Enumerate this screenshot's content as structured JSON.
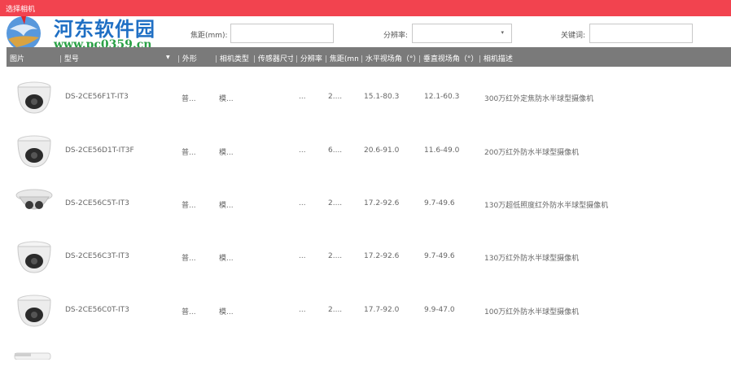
{
  "window": {
    "title": "选择相机"
  },
  "watermark": {
    "site_name": "河东软件园",
    "url": "www.pc0359.cn"
  },
  "filters": {
    "focal_label": "焦距(mm):",
    "focal_value": "",
    "resolution_label": "分辨率:",
    "resolution_value": "",
    "keyword_label": "关键词:",
    "keyword_value": ""
  },
  "columns": [
    "图片",
    "型号",
    "外形",
    "相机类型",
    "传感器尺寸",
    "分辨率",
    "焦距(mm",
    "水平视场角（°）",
    "垂直视场角（°）",
    "相机描述"
  ],
  "rows": [
    {
      "model": "DS-2CE56F1T-IT3",
      "shape": "普...",
      "type": "模...",
      "sensor": "",
      "resolution": "...",
      "focal": "2....",
      "hfov": "15.1-80.3",
      "vfov": "12.1-60.3",
      "desc": "300万红外定焦防水半球型摄像机",
      "icon": "dome-camera-icon"
    },
    {
      "model": "DS-2CE56D1T-IT3F",
      "shape": "普...",
      "type": "模...",
      "sensor": "",
      "resolution": "...",
      "focal": "6....",
      "hfov": "20.6-91.0",
      "vfov": "11.6-49.0",
      "desc": "200万红外防水半球型摄像机",
      "icon": "dome-camera-icon"
    },
    {
      "model": "DS-2CE56C5T-IT3",
      "shape": "普...",
      "type": "模...",
      "sensor": "",
      "resolution": "...",
      "focal": "2....",
      "hfov": "17.2-92.6",
      "vfov": "9.7-49.6",
      "desc": "130万超低照度红外防水半球型摄像机",
      "icon": "dome-camera-icon"
    },
    {
      "model": "DS-2CE56C3T-IT3",
      "shape": "普...",
      "type": "模...",
      "sensor": "",
      "resolution": "...",
      "focal": "2....",
      "hfov": "17.2-92.6",
      "vfov": "9.7-49.6",
      "desc": "130万红外防水半球型摄像机",
      "icon": "dome-camera-icon"
    },
    {
      "model": "DS-2CE56C0T-IT3",
      "shape": "普...",
      "type": "模...",
      "sensor": "",
      "resolution": "...",
      "focal": "2....",
      "hfov": "17.7-92.0",
      "vfov": "9.9-47.0",
      "desc": "100万红外防水半球型摄像机",
      "icon": "dome-camera-icon"
    }
  ],
  "colors": {
    "titlebar": "#f2434f",
    "header": "#7a7a7a",
    "watermark_blue": "#1f6fc4",
    "watermark_green": "#2aa146"
  }
}
